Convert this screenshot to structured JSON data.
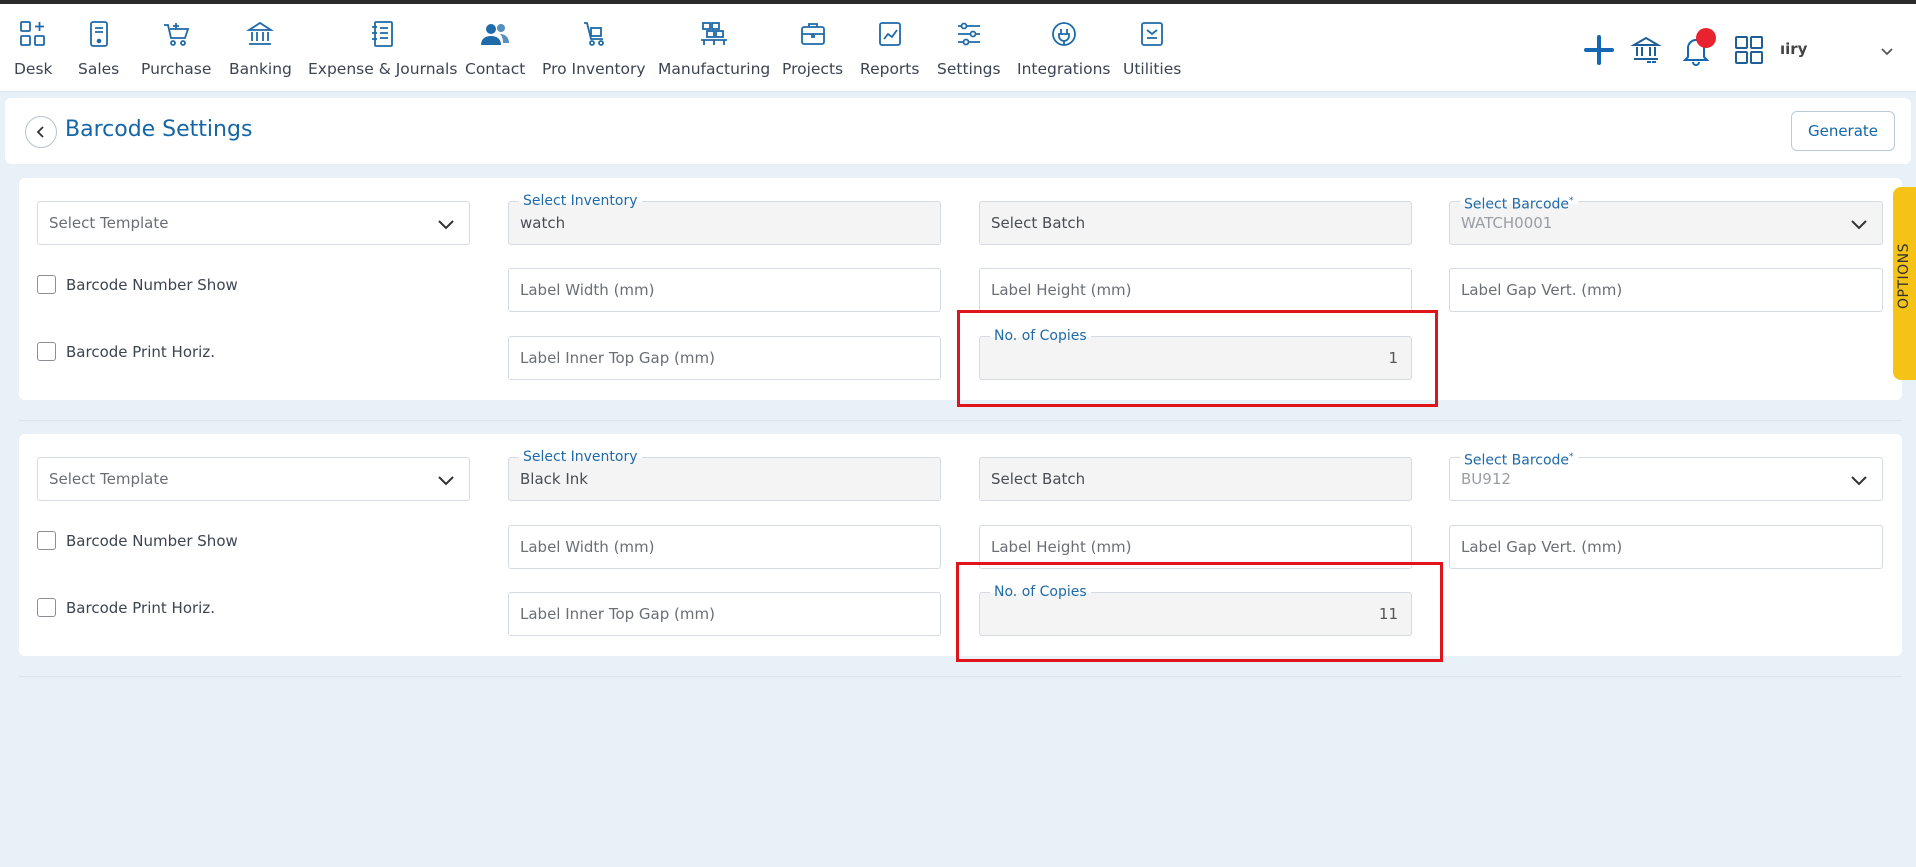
{
  "nav": {
    "items": [
      {
        "label": "Desk",
        "icon": "desk-icon"
      },
      {
        "label": "Sales",
        "icon": "sales-icon"
      },
      {
        "label": "Purchase",
        "icon": "purchase-icon"
      },
      {
        "label": "Banking",
        "icon": "banking-icon"
      },
      {
        "label": "Expense & Journals",
        "icon": "expense-icon"
      },
      {
        "label": "Contact",
        "icon": "contact-icon"
      },
      {
        "label": "Pro Inventory",
        "icon": "inventory-icon"
      },
      {
        "label": "Manufacturing",
        "icon": "manufacturing-icon"
      },
      {
        "label": "Projects",
        "icon": "projects-icon"
      },
      {
        "label": "Reports",
        "icon": "reports-icon"
      },
      {
        "label": "Settings",
        "icon": "settings-icon"
      },
      {
        "label": "Integrations",
        "icon": "integrations-icon"
      },
      {
        "label": "Utilities",
        "icon": "utilities-icon"
      }
    ],
    "user_name": "ıiry"
  },
  "header": {
    "title": "Barcode Settings",
    "generate_label": "Generate"
  },
  "panels": [
    {
      "template_placeholder": "Select Template",
      "inventory_label": "Select Inventory",
      "inventory_value": "watch",
      "batch_placeholder": "Select Batch",
      "barcode_label": "Select Barcode",
      "barcode_required": "*",
      "barcode_value": "WATCH0001",
      "number_show_label": "Barcode Number Show",
      "print_horiz_label": "Barcode Print Horiz.",
      "label_width": "Label Width (mm)",
      "label_height": "Label Height (mm)",
      "label_gap_vert": "Label Gap Vert. (mm)",
      "label_inner_top_gap": "Label Inner Top Gap (mm)",
      "copies_label": "No. of Copies",
      "copies_value": "1"
    },
    {
      "template_placeholder": "Select Template",
      "inventory_label": "Select Inventory",
      "inventory_value": "Black Ink",
      "batch_placeholder": "Select Batch",
      "barcode_label": "Select Barcode",
      "barcode_required": "*",
      "barcode_value": "BU912",
      "number_show_label": "Barcode Number Show",
      "print_horiz_label": "Barcode Print Horiz.",
      "label_width": "Label Width (mm)",
      "label_height": "Label Height (mm)",
      "label_gap_vert": "Label Gap Vert. (mm)",
      "label_inner_top_gap": "Label Inner Top Gap (mm)",
      "copies_label": "No. of Copies",
      "copies_value": "11"
    }
  ],
  "side_tab": {
    "label": "OPTIONS"
  },
  "colors": {
    "accent": "#1566a6",
    "highlight": "#e0141b",
    "options_tab": "#f5c315",
    "notification": "#e8232f"
  }
}
